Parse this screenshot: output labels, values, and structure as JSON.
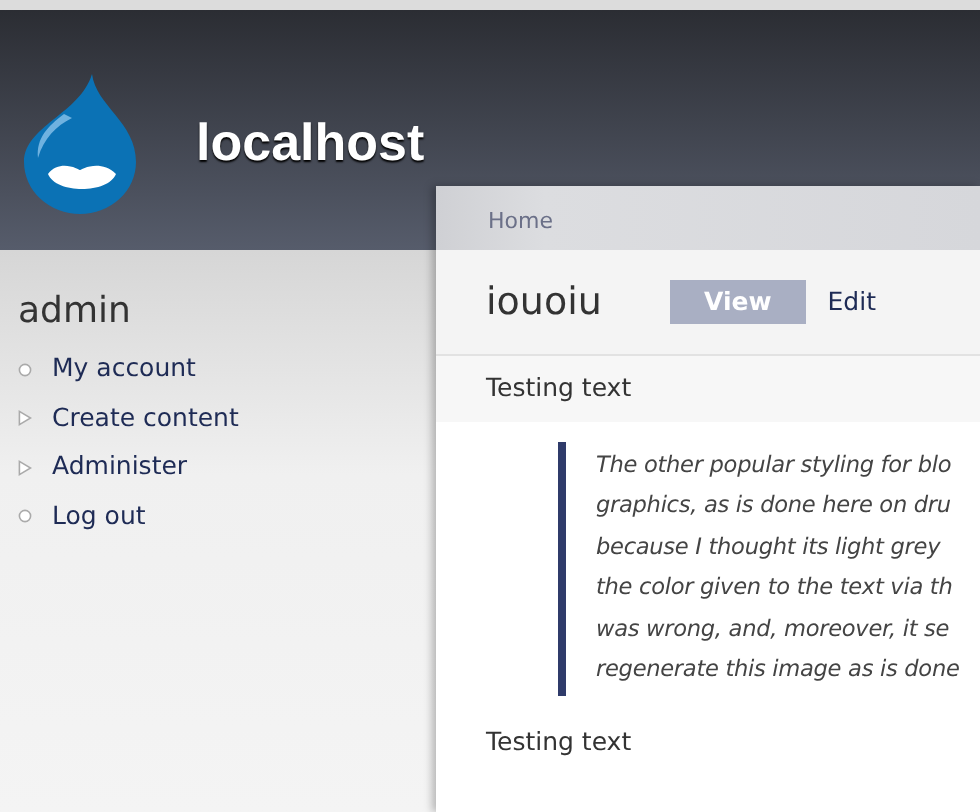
{
  "site": {
    "name": "localhost"
  },
  "sidebar": {
    "title": "admin",
    "items": [
      {
        "label": "My account",
        "kind": "leaf"
      },
      {
        "label": "Create content",
        "kind": "collapsed"
      },
      {
        "label": "Administer",
        "kind": "collapsed"
      },
      {
        "label": "Log out",
        "kind": "leaf"
      }
    ]
  },
  "breadcrumb": [
    "Home"
  ],
  "page": {
    "title": "iouoiu",
    "tabs": [
      {
        "label": "View",
        "selected": true
      },
      {
        "label": "Edit",
        "selected": false
      }
    ],
    "content": [
      {
        "kind": "paragraph",
        "text": "Testing text"
      },
      {
        "kind": "blockquote",
        "lines": [
          "The other popular styling for blo",
          "graphics, as is done here on dru",
          "because I thought its light grey",
          "the color given to the text via th",
          "was wrong, and, moreover, it se",
          "regenerate this image as is done"
        ]
      },
      {
        "kind": "paragraph",
        "text": "Testing text"
      }
    ]
  }
}
